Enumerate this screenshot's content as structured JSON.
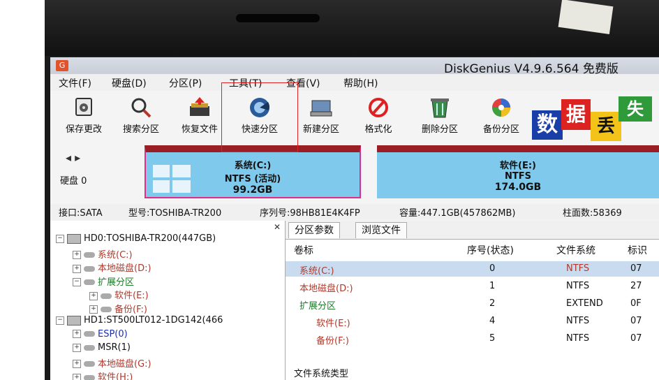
{
  "app": {
    "title": "DiskGenius V4.9.6.564 免费版"
  },
  "menu": [
    "文件(F)",
    "硬盘(D)",
    "分区(P)",
    "工具(T)",
    "查看(V)",
    "帮助(H)"
  ],
  "toolbar": [
    {
      "label": "保存更改",
      "icon": "save-disk-icon"
    },
    {
      "label": "搜索分区",
      "icon": "magnifier-icon"
    },
    {
      "label": "恢复文件",
      "icon": "restore-box-icon"
    },
    {
      "label": "快速分区",
      "icon": "quick-partition-icon"
    },
    {
      "label": "新建分区",
      "icon": "new-partition-icon"
    },
    {
      "label": "格式化",
      "icon": "format-icon"
    },
    {
      "label": "删除分区",
      "icon": "delete-trash-icon"
    },
    {
      "label": "备份分区",
      "icon": "backup-icon"
    }
  ],
  "banner": {
    "chars": [
      "数",
      "据",
      "丢",
      "失"
    ]
  },
  "diskmap": {
    "disk_label": "硬盘 0",
    "partitions": [
      {
        "name": "系统(C:)",
        "fs": "NTFS (活动)",
        "size": "99.2GB"
      },
      {
        "name": "软件(E:)",
        "fs": "NTFS",
        "size": "174.0GB"
      }
    ]
  },
  "infobar": {
    "interface": "接口:SATA",
    "model": "型号:TOSHIBA-TR200",
    "serial": "序列号:98HB81E4K4FP",
    "capacity": "容量:447.1GB(457862MB)",
    "cylinders": "柱面数:58369"
  },
  "tree": [
    {
      "text": "HD0:TOSHIBA-TR200(447GB)",
      "color": "c-black",
      "level": 0,
      "type": "disk"
    },
    {
      "text": "系统(C:)",
      "color": "c-red",
      "level": 1,
      "type": "part"
    },
    {
      "text": "本地磁盘(D:)",
      "color": "c-red",
      "level": 1,
      "type": "part"
    },
    {
      "text": "扩展分区",
      "color": "c-green",
      "level": 1,
      "type": "ext"
    },
    {
      "text": "软件(E:)",
      "color": "c-red",
      "level": 2,
      "type": "part"
    },
    {
      "text": "备份(F:)",
      "color": "c-red",
      "level": 2,
      "type": "part"
    },
    {
      "text": "HD1:ST500LT012-1DG142(466",
      "color": "c-black",
      "level": 0,
      "type": "disk"
    },
    {
      "text": "ESP(0)",
      "color": "c-blue",
      "level": 1,
      "type": "part"
    },
    {
      "text": "MSR(1)",
      "color": "c-black",
      "level": 1,
      "type": "part"
    },
    {
      "text": "本地磁盘(G:)",
      "color": "c-red",
      "level": 1,
      "type": "part"
    },
    {
      "text": "软件(H:)",
      "color": "c-red",
      "level": 1,
      "type": "part"
    }
  ],
  "tabs": [
    "分区参数",
    "浏览文件"
  ],
  "table": {
    "headers": [
      "卷标",
      "序号(状态)",
      "文件系统",
      "标识"
    ],
    "rows": [
      {
        "label": "系统(C:)",
        "num": "0",
        "fs": "NTFS",
        "id": "07",
        "color": "c-red",
        "fscolor": "c-red"
      },
      {
        "label": "本地磁盘(D:)",
        "num": "1",
        "fs": "NTFS",
        "id": "27",
        "color": "c-red",
        "fscolor": "c-black"
      },
      {
        "label": "扩展分区",
        "num": "2",
        "fs": "EXTEND",
        "id": "0F",
        "color": "c-green",
        "fscolor": "c-black"
      },
      {
        "label": "软件(E:)",
        "num": "4",
        "fs": "NTFS",
        "id": "07",
        "color": "c-red",
        "fscolor": "c-black"
      },
      {
        "label": "备份(F:)",
        "num": "5",
        "fs": "NTFS",
        "id": "07",
        "color": "c-red",
        "fscolor": "c-black"
      }
    ],
    "footer": "文件系统类型"
  },
  "colors": {
    "partition_fill": "#7ec9ec",
    "partition_top": "#9a1f24",
    "selected_border": "#e02d8c",
    "highlight_box": "#dd2222"
  }
}
